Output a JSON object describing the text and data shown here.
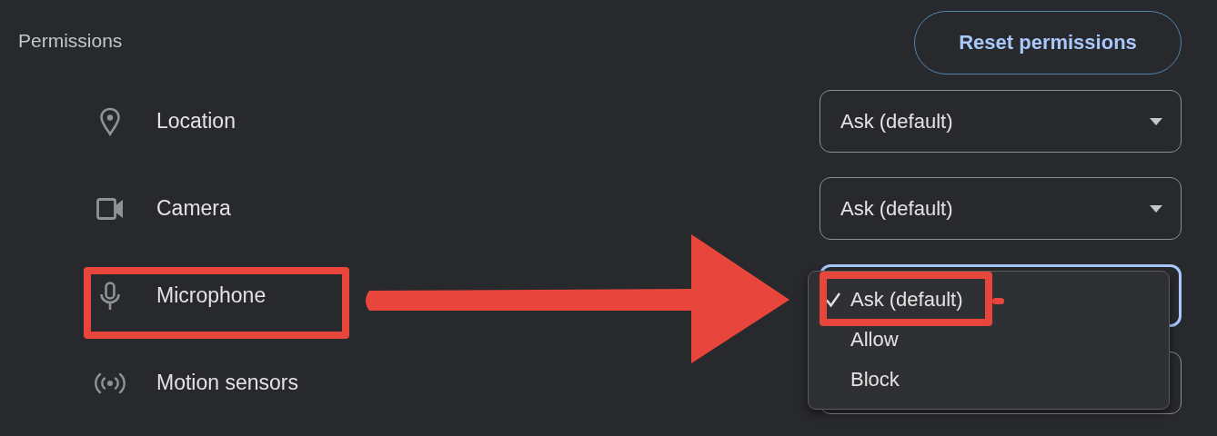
{
  "section": {
    "title": "Permissions"
  },
  "reset_button": {
    "label": "Reset permissions"
  },
  "rows": [
    {
      "kind": "location",
      "label": "Location",
      "value": "Ask (default)",
      "focused": false,
      "highlighted": false
    },
    {
      "kind": "camera",
      "label": "Camera",
      "value": "Ask (default)",
      "focused": false,
      "highlighted": false
    },
    {
      "kind": "microphone",
      "label": "Microphone",
      "focused": true,
      "highlighted": true,
      "dropdown": {
        "options": [
          {
            "label": "Ask (default)",
            "selected": true,
            "highlighted": true
          },
          {
            "label": "Allow",
            "selected": false,
            "highlighted": false
          },
          {
            "label": "Block",
            "selected": false,
            "highlighted": false
          }
        ]
      }
    },
    {
      "kind": "motion",
      "label": "Motion sensors",
      "focused": false,
      "highlighted": false
    }
  ]
}
